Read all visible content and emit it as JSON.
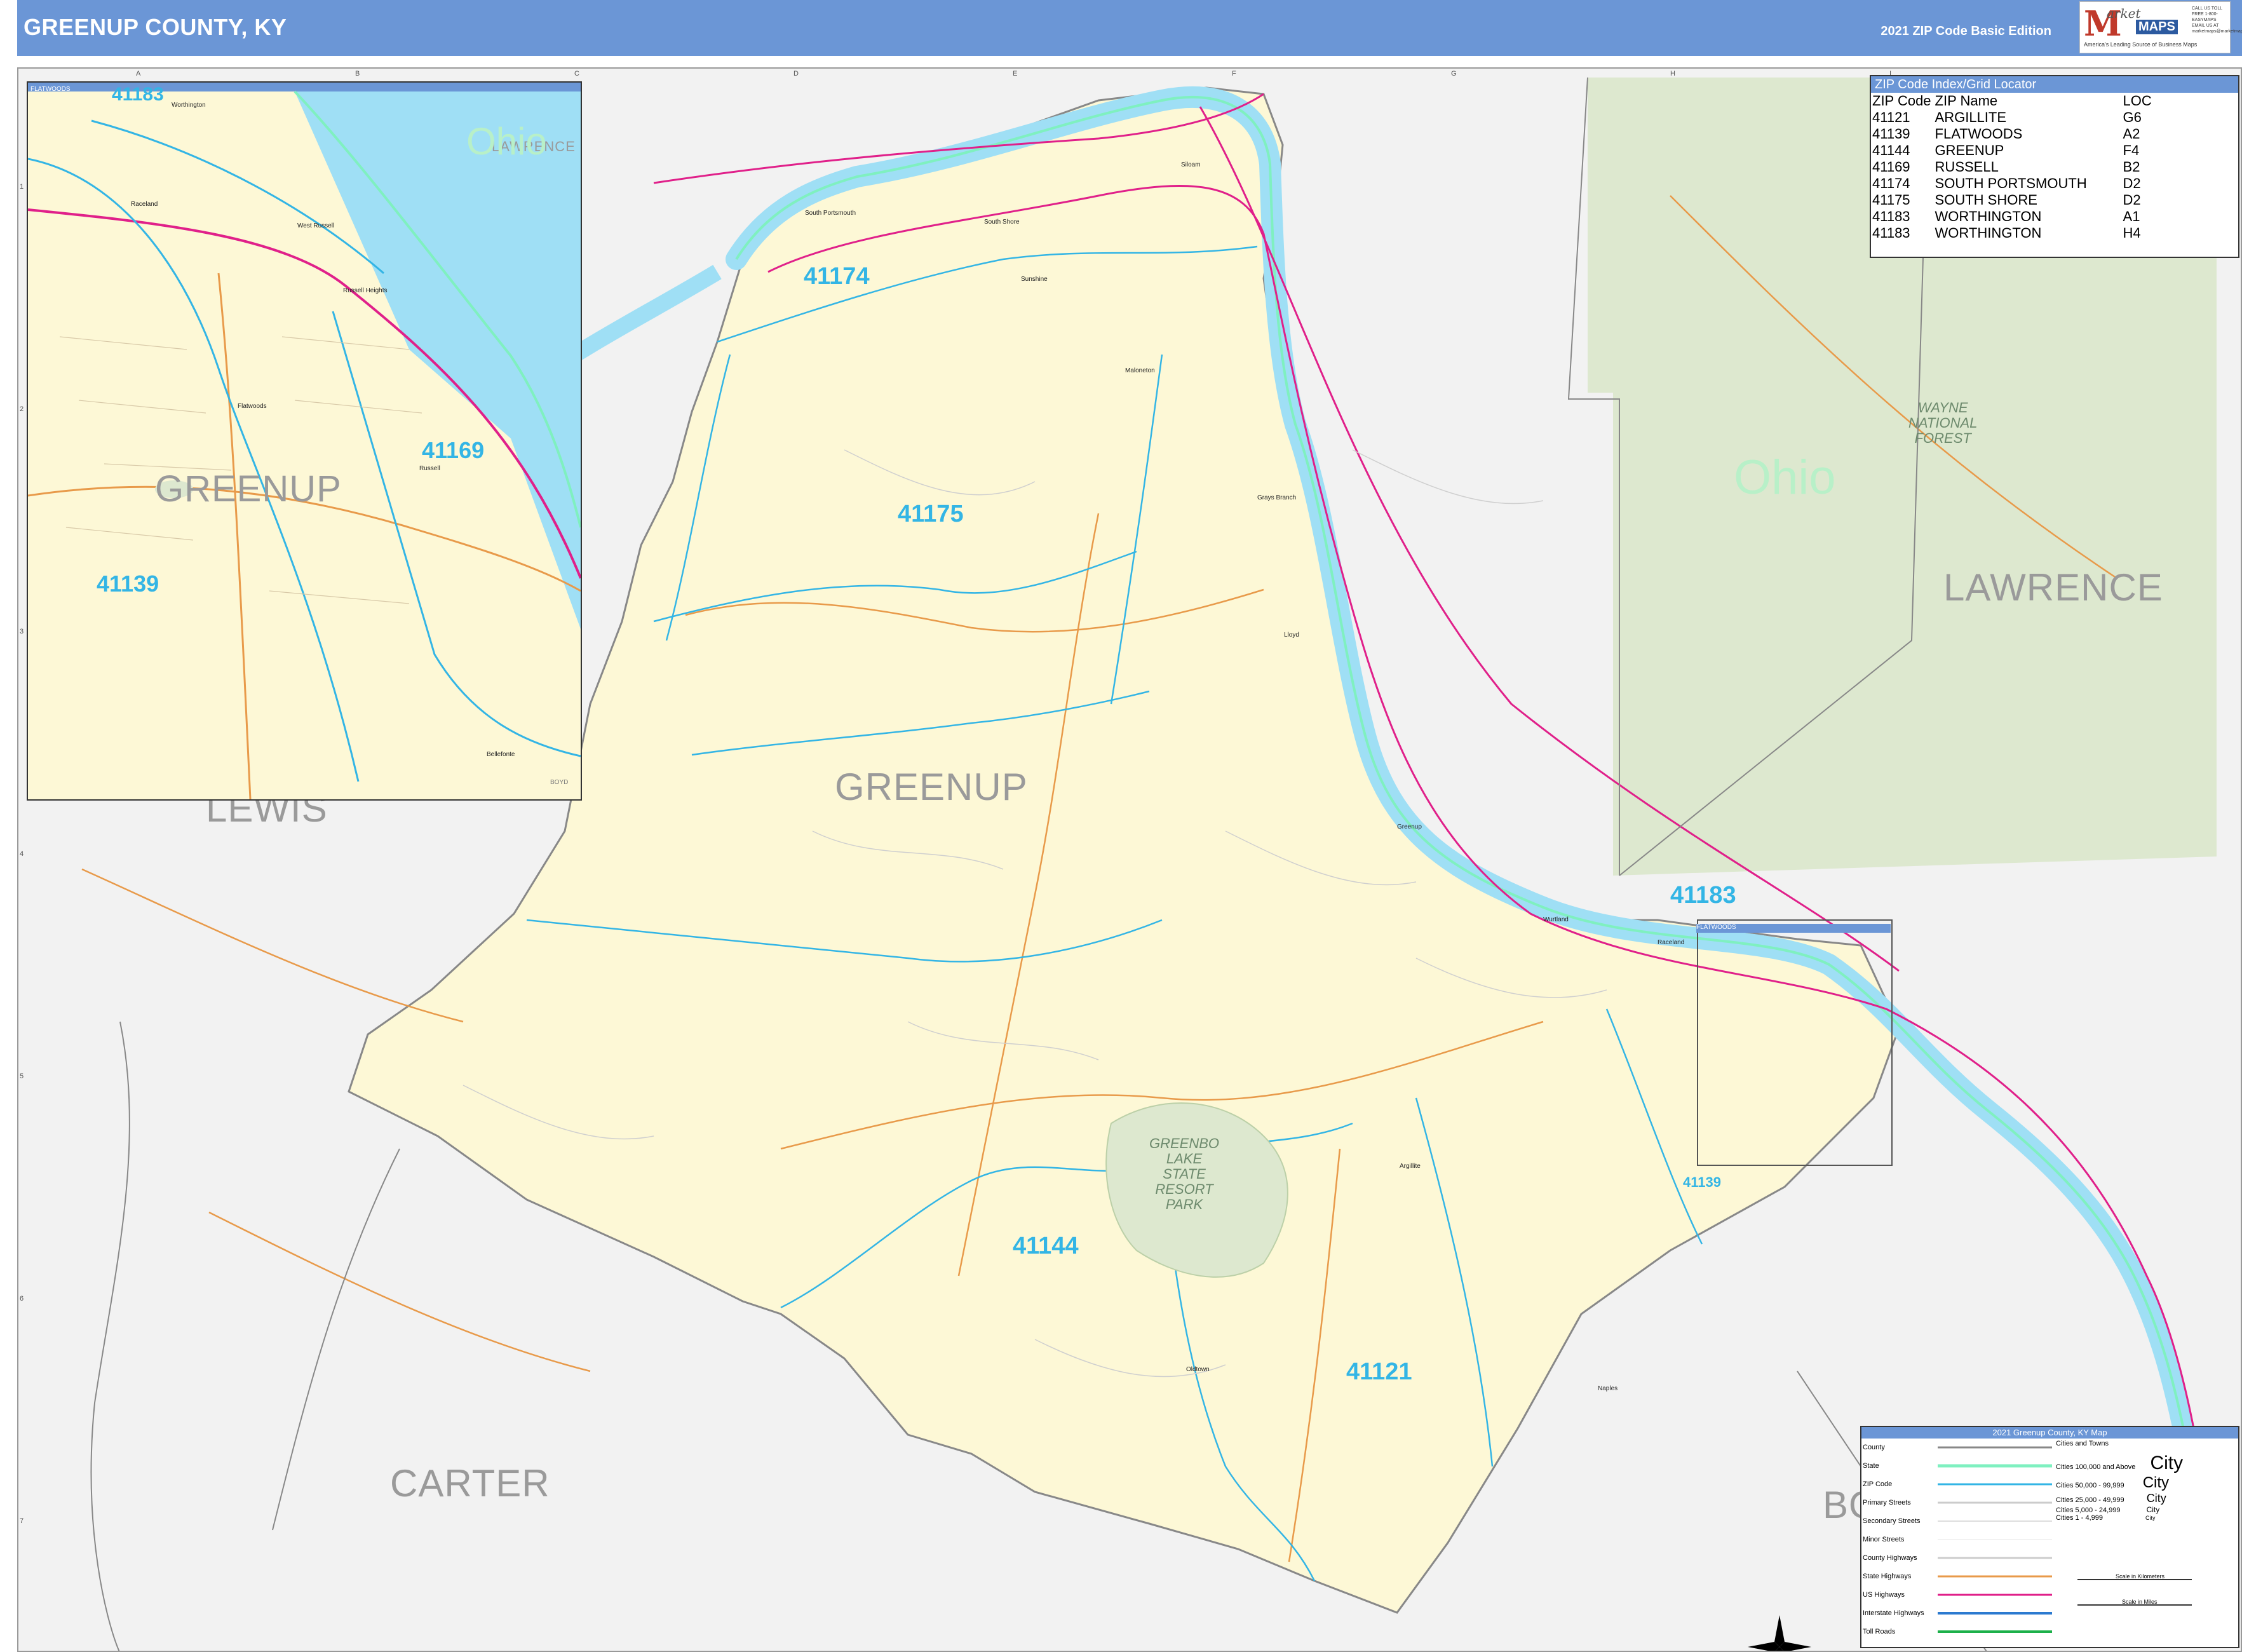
{
  "header": {
    "title": "GREENUP COUNTY, KY",
    "edition": "2021 ZIP Code Basic Edition"
  },
  "logo": {
    "m": "M",
    "wordmark": "arket",
    "maps": "MAPS",
    "tagline": "America's Leading Source of Business Maps",
    "contact": "CALL US TOLL FREE 1-800-EASYMAPS EMAIL US AT marketmaps@marketmaps.com",
    "slogan": "On Target. On Time."
  },
  "grid": {
    "columns": [
      "A",
      "B",
      "C",
      "D",
      "E",
      "F",
      "G",
      "H",
      "I"
    ],
    "rows": [
      "1",
      "2",
      "3",
      "4",
      "5",
      "6",
      "7"
    ]
  },
  "counties": {
    "lewis": "LEWIS",
    "greenup": "GREENUP",
    "carter": "CARTER",
    "lawrence": "LAWRENCE",
    "boyd_partial": "BO"
  },
  "states": {
    "ohio": "Ohio"
  },
  "zips": {
    "z41174": "41174",
    "z41175": "41175",
    "z41144": "41144",
    "z41121": "41121",
    "z41183": "41183",
    "z41139": "41139"
  },
  "park": {
    "label_lines": [
      "GREENBO",
      "LAKE",
      "STATE",
      "RESORT",
      "PARK"
    ]
  },
  "forest": {
    "label_lines": [
      "WAYNE",
      "NATIONAL",
      "FOREST"
    ]
  },
  "cities": {
    "south_portsmouth": "South Portsmouth",
    "south_shore": "South Shore",
    "sunshine": "Sunshine",
    "siloam": "Siloam",
    "maloneton": "Maloneton",
    "grays_branch": "Grays Branch",
    "lloyd": "Lloyd",
    "greenup": "Greenup",
    "wurtland": "Wurtland",
    "raceland": "Raceland",
    "argillite": "Argillite",
    "oldtown": "Oldtown",
    "naples": "Naples"
  },
  "inset": {
    "tag": "FLATWOODS",
    "county_greenup": "GREENUP",
    "county_lawrence": "LAWRENCE",
    "state_ohio": "Ohio",
    "boyd": "BOYD",
    "zip_41183": "41183",
    "zip_41169": "41169",
    "zip_41139": "41139",
    "cities": {
      "worthington": "Worthington",
      "raceland": "Raceland",
      "west_russell": "West Russell",
      "russell_heights": "Russell Heights",
      "flatwoods": "Flatwoods",
      "russell": "Russell",
      "bellefonte": "Bellefonte"
    }
  },
  "zip_index": {
    "title": "ZIP Code Index/Grid Locator",
    "headers": [
      "ZIP Code",
      "ZIP Name",
      "LOC"
    ],
    "rows": [
      [
        "41121",
        "ARGILLITE",
        "G6"
      ],
      [
        "41139",
        "FLATWOODS",
        "A2"
      ],
      [
        "41144",
        "GREENUP",
        "F4"
      ],
      [
        "41169",
        "RUSSELL",
        "B2"
      ],
      [
        "41174",
        "SOUTH PORTSMOUTH",
        "D2"
      ],
      [
        "41175",
        "SOUTH SHORE",
        "D2"
      ],
      [
        "41183",
        "WORTHINGTON",
        "A1"
      ],
      [
        "41183",
        "WORTHINGTON",
        "H4"
      ]
    ]
  },
  "legend": {
    "title": "2021 Greenup County, KY Map",
    "items": [
      "County",
      "State",
      "ZIP Code",
      "Primary Streets",
      "Secondary Streets",
      "Minor Streets",
      "County Highways",
      "State Highways",
      "US Highways",
      "Interstate Highways",
      "Toll Roads"
    ],
    "cities_header": "Cities and Towns",
    "city_sizes": [
      "Cities 100,000 and Above",
      "Cities 50,000 - 99,999",
      "Cities 25,000 - 49,999",
      "Cities 5,000 - 24,999",
      "Cities 1 - 4,999"
    ],
    "city_sample": [
      "City",
      "City",
      "City",
      "City",
      "City"
    ],
    "scale_km": "Scale in Kilometers",
    "scale_mi": "Scale in Miles"
  },
  "colors": {
    "header": "#6b96d6",
    "county_fill": "#fdf8d6",
    "river": "#9fdff5",
    "zip_boundary": "#33b5e5",
    "state_line": "#7ff0c0",
    "us_highway": "#e0208a",
    "state_highway": "#e89a4a",
    "forest": "#dde8cf"
  }
}
